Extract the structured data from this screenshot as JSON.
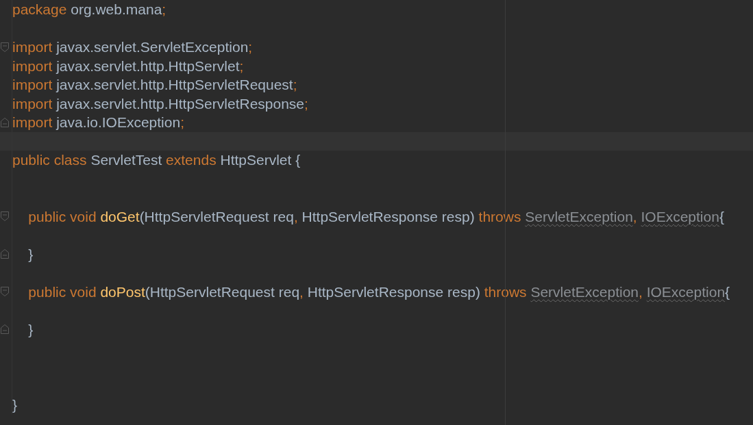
{
  "editor": {
    "lines": [
      {
        "kind": "plain",
        "tokens": [
          {
            "kind": "keyword",
            "text": "package"
          },
          {
            "kind": "plain",
            "text": " org.web.mana"
          },
          {
            "kind": "keyword",
            "text": ";"
          }
        ]
      },
      {
        "kind": "plain"
      },
      {
        "kind": "opener",
        "tokens": [
          {
            "kind": "keyword",
            "text": "import"
          },
          {
            "kind": "plain",
            "text": " javax.servlet.ServletException"
          },
          {
            "kind": "keyword",
            "text": ";"
          }
        ]
      },
      {
        "kind": "plain",
        "tokens": [
          {
            "kind": "keyword",
            "text": "import"
          },
          {
            "kind": "plain",
            "text": " javax.servlet.http.HttpServlet"
          },
          {
            "kind": "keyword",
            "text": ";"
          }
        ]
      },
      {
        "kind": "plain",
        "tokens": [
          {
            "kind": "keyword",
            "text": "import"
          },
          {
            "kind": "plain",
            "text": " javax.servlet.http.HttpServletRequest"
          },
          {
            "kind": "keyword",
            "text": ";"
          }
        ]
      },
      {
        "kind": "plain",
        "tokens": [
          {
            "kind": "keyword",
            "text": "import"
          },
          {
            "kind": "plain",
            "text": " javax.servlet.http.HttpServletResponse"
          },
          {
            "kind": "keyword",
            "text": ";"
          }
        ]
      },
      {
        "kind": "closer",
        "tokens": [
          {
            "kind": "keyword",
            "text": "import"
          },
          {
            "kind": "plain",
            "text": " java.io.IOException"
          },
          {
            "kind": "keyword",
            "text": ";"
          }
        ]
      },
      {
        "kind": "current"
      },
      {
        "kind": "plain",
        "tokens": [
          {
            "kind": "keyword",
            "text": "public class"
          },
          {
            "kind": "plain",
            "text": " ServletTest "
          },
          {
            "kind": "keyword",
            "text": "extends"
          },
          {
            "kind": "plain",
            "text": " HttpServlet {"
          }
        ]
      },
      {
        "kind": "plain"
      },
      {
        "kind": "plain"
      },
      {
        "kind": "opener",
        "tokens": [
          {
            "kind": "keyword",
            "text": "    public void "
          },
          {
            "kind": "method",
            "text": "doGet"
          },
          {
            "kind": "plain",
            "text": "(HttpServletRequest req"
          },
          {
            "kind": "keyword",
            "text": ","
          },
          {
            "kind": "plain",
            "text": " HttpServletResponse resp) "
          },
          {
            "kind": "keyword",
            "text": "throws "
          },
          {
            "kind": "warning",
            "text": "ServletException"
          },
          {
            "kind": "keyword",
            "text": ", "
          },
          {
            "kind": "warning",
            "text": "IOException"
          },
          {
            "kind": "plain",
            "text": "{"
          }
        ]
      },
      {
        "kind": "plain"
      },
      {
        "kind": "closer",
        "tokens": [
          {
            "kind": "plain",
            "text": "    }"
          }
        ]
      },
      {
        "kind": "plain"
      },
      {
        "kind": "opener",
        "tokens": [
          {
            "kind": "keyword",
            "text": "    public void "
          },
          {
            "kind": "method",
            "text": "doPost"
          },
          {
            "kind": "plain",
            "text": "(HttpServletRequest req"
          },
          {
            "kind": "keyword",
            "text": ","
          },
          {
            "kind": "plain",
            "text": " HttpServletResponse resp) "
          },
          {
            "kind": "keyword",
            "text": "throws "
          },
          {
            "kind": "warning",
            "text": "ServletException"
          },
          {
            "kind": "keyword",
            "text": ", "
          },
          {
            "kind": "warning",
            "text": "IOException"
          },
          {
            "kind": "plain",
            "text": "{"
          }
        ]
      },
      {
        "kind": "plain"
      },
      {
        "kind": "closer",
        "tokens": [
          {
            "kind": "plain",
            "text": "    }"
          }
        ]
      },
      {
        "kind": "plain"
      },
      {
        "kind": "plain"
      },
      {
        "kind": "plain"
      },
      {
        "kind": "plain",
        "tokens": [
          {
            "kind": "plain",
            "text": "}"
          }
        ]
      }
    ]
  }
}
